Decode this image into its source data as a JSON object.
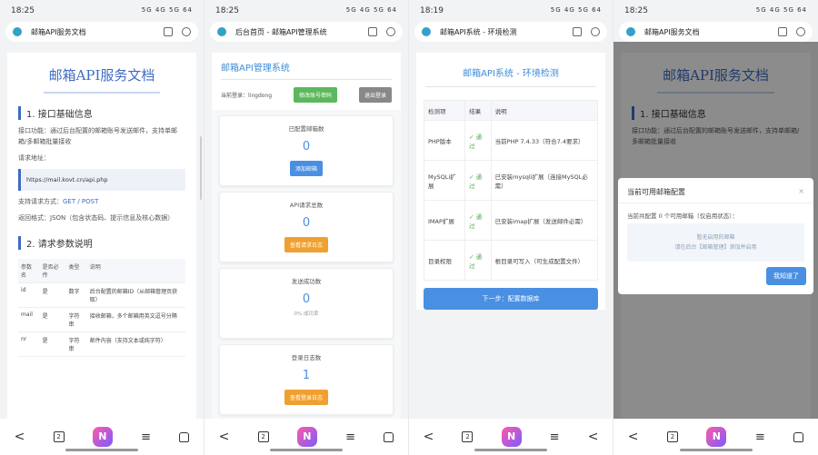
{
  "panels": {
    "p1": {
      "time": "18:25",
      "signal": "5G 4G 5G 64",
      "url": "邮箱API服务文档"
    },
    "p2": {
      "time": "18:25",
      "signal": "5G 4G 5G 64",
      "url": "后台首页 - 邮箱API管理系统"
    },
    "p3": {
      "time": "18:19",
      "signal": "5G 4G 5G 64",
      "url": "邮箱API系统 - 环境检测"
    },
    "p4": {
      "time": "18:25",
      "signal": "5G 4G 5G 64",
      "url": "邮箱API服务文档"
    }
  },
  "nav": {
    "back": "<",
    "tabs": "2",
    "ai": "N",
    "menu": "≡",
    "home": ""
  },
  "doc": {
    "title": "邮箱API服务文档",
    "sec1": "1. 接口基础信息",
    "func": "接口功能：通过后台配置的邮箱账号发送邮件，支持单邮箱/多邮箱批量接收",
    "req_label": "请求地址：",
    "req_url": "https://mail.kovt.cn/api.php",
    "method_label": "支持请求方式：",
    "method": "GET / POST",
    "ret": "返回格式：JSON（包含状态码、提示信息及核心数据）",
    "sec2": "2. 请求参数说明",
    "headers": [
      "参数名",
      "是否必传",
      "类型",
      "说明"
    ],
    "rows": [
      [
        "id",
        "是",
        "数字",
        "后台配置的邮箱ID（从邮箱管理页获取）"
      ],
      [
        "mail",
        "是",
        "字符串",
        "接收邮箱，多个邮箱用英文逗号分隔"
      ],
      [
        "nr",
        "是",
        "字符串",
        "邮件内容（支持文本或纯字符）"
      ]
    ]
  },
  "admin": {
    "title": "邮箱API管理系统",
    "user": "当前登录：lingdong",
    "change_pw": "修改账号密码",
    "logout": "退出登录",
    "cards": [
      {
        "label": "已配置邮箱数",
        "value": "0",
        "button": "添加邮箱",
        "sub": ""
      },
      {
        "label": "API请求总数",
        "value": "0",
        "button": "查看请求日志",
        "sub": ""
      },
      {
        "label": "发送成功数",
        "value": "0",
        "button": "",
        "sub": "0% 成功率"
      },
      {
        "label": "登录日志数",
        "value": "1",
        "button": "查看登录日志",
        "sub": ""
      }
    ]
  },
  "env": {
    "title": "邮箱API系统 - 环境检测",
    "headers": [
      "检测项",
      "结果",
      "说明"
    ],
    "rows": [
      [
        "PHP版本",
        "✓ 通过",
        "当前PHP 7.4.33（符合7.4要求）"
      ],
      [
        "MySQLi扩展",
        "✓ 通过",
        "已安装mysqli扩展（连接MySQL必需）"
      ],
      [
        "IMAP扩展",
        "✓ 通过",
        "已安装imap扩展（发送邮件必需）"
      ],
      [
        "目录权限",
        "✓ 通过",
        "根目录可写入（可生成配置文件）"
      ]
    ],
    "next": "下一步：配置数据库"
  },
  "modal": {
    "title": "当前可用邮箱配置",
    "close": "×",
    "text": "当前共配置 0 个可用邮箱（仅启用状态）：",
    "empty1": "暂无启用的邮箱",
    "empty2": "请在后台【邮箱管理】添加并启用",
    "ok": "我知道了"
  },
  "colors": {
    "accent": "#3f6cc2",
    "green": "#5cb85c",
    "orange": "#f0a030",
    "blue": "#4a90e2"
  }
}
